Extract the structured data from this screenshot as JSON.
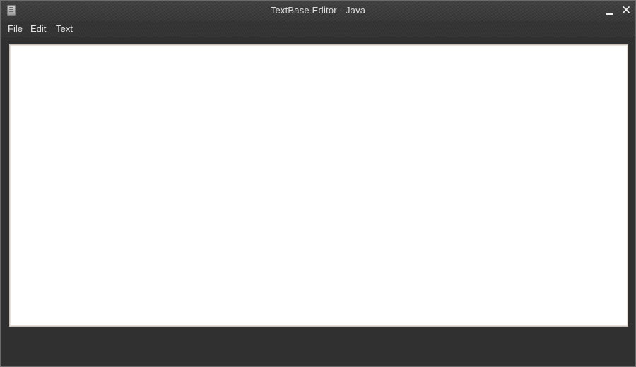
{
  "window": {
    "title": "TextBase Editor - Java",
    "app_icon": "notepad-icon",
    "controls": {
      "minimize_icon": "minimize-icon",
      "close_icon": "close-icon",
      "close_glyph": "✕"
    }
  },
  "menubar": {
    "items": [
      {
        "label": "File"
      },
      {
        "label": "Edit"
      },
      {
        "label": "Text"
      }
    ]
  },
  "editor": {
    "content": ""
  },
  "colors": {
    "window_background": "#303030",
    "editor_background": "#ffffff",
    "title_text": "#dcdcdc",
    "menu_text": "#e6e6e6"
  }
}
